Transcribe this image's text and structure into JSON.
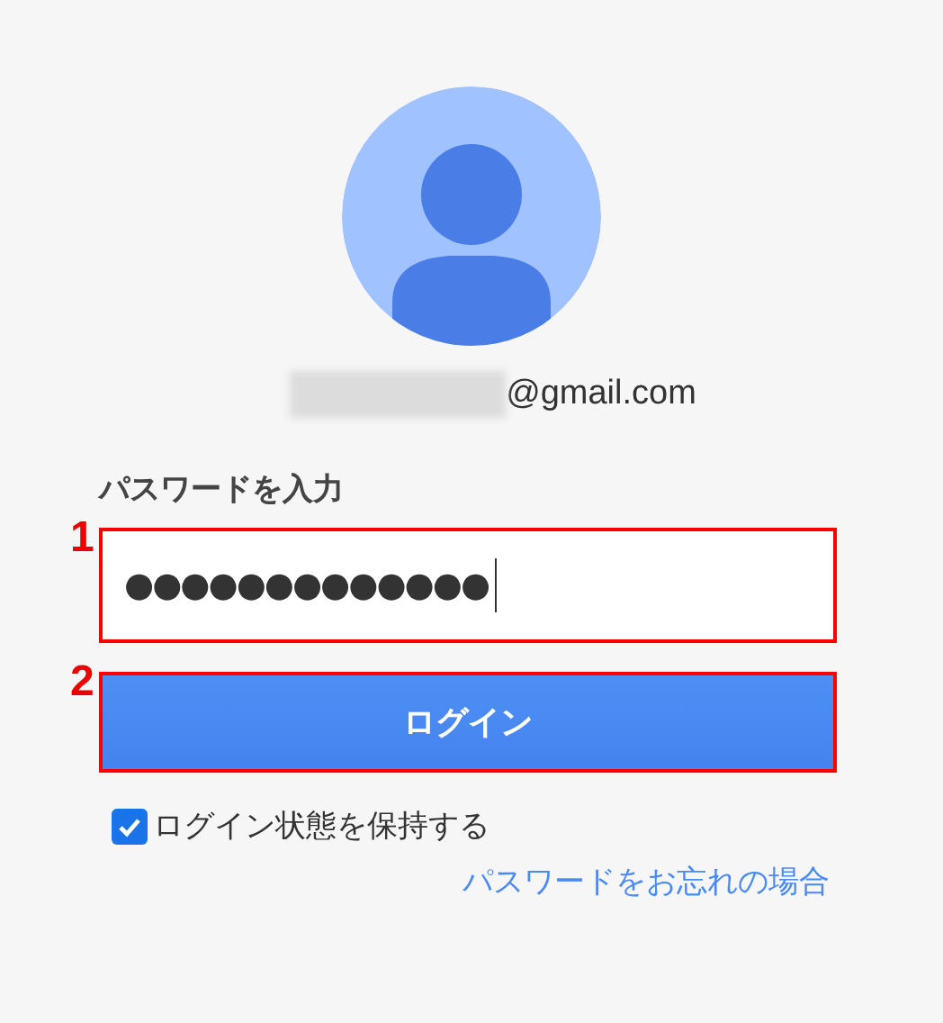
{
  "account": {
    "email_suffix": "@gmail.com",
    "redacted": true
  },
  "password": {
    "label": "パスワードを入力",
    "value": "●●●●●●●●●●●●●",
    "marker": "1"
  },
  "login_button": {
    "label": "ログイン",
    "marker": "2"
  },
  "remember": {
    "label": "ログイン状態を保持する",
    "checked": true
  },
  "forgot_link": "パスワードをお忘れの場合"
}
